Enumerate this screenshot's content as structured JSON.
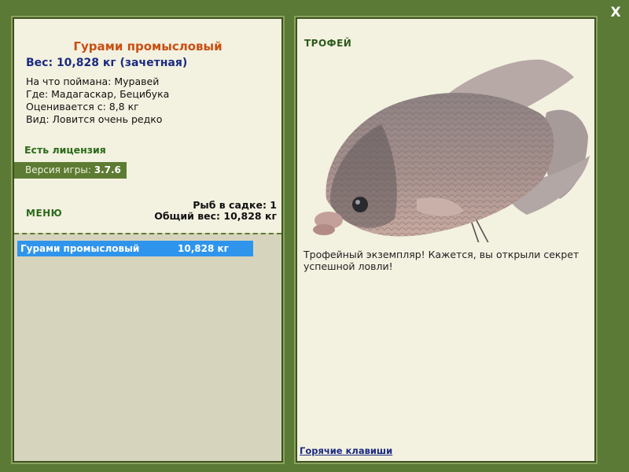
{
  "close_label": "X",
  "fish": {
    "name": "Гурами промысловый",
    "weight_line": "Вес: 10,828 кг (зачетная)",
    "caught_with": "На что поймана: Муравей",
    "where": "Где: Мадагаскар, Бецибука",
    "rated_from": "Оценивается с: 8,8 кг",
    "rarity": "Вид: Ловится очень редко"
  },
  "license": "Есть лицензия",
  "version": {
    "label": "Версия игры:",
    "value": "3.7.6"
  },
  "menu_label": "МЕНЮ",
  "stats": {
    "count": "Рыб в садке: 1",
    "total": "Общий вес: 10,828 кг"
  },
  "catch_list": [
    {
      "name": "Гурами промысловый",
      "weight": "10,828 кг"
    }
  ],
  "right_panel": {
    "trophy_label": "ТРОФЕЙ",
    "description": "Трофейный экземпляр! Кажется, вы открыли секрет успешной ловли!",
    "hotkeys": "Горячие клавиши"
  },
  "colors": {
    "background": "#5a7a35",
    "panel": "#f3f1e0",
    "title": "#c94f12",
    "weight": "#1b2a80",
    "selected_row": "#2f95ec"
  }
}
